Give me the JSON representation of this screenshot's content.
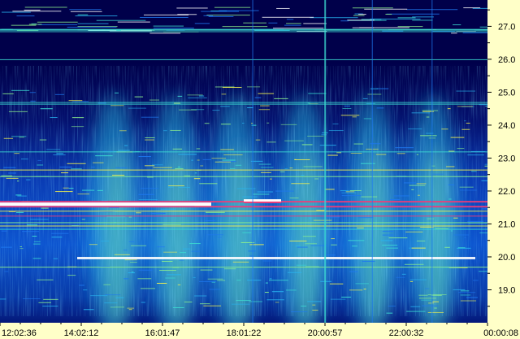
{
  "chart_data": {
    "type": "heatmap",
    "title": "",
    "xlabel": "",
    "ylabel": "",
    "x_ticks": [
      "12:02:36",
      "14:02:12",
      "16:01:47",
      "18:01:22",
      "20:00:57",
      "22:00:32",
      "00:00:08"
    ],
    "y_ticks": [
      27.0,
      26.0,
      25.0,
      24.0,
      23.0,
      22.0,
      21.0,
      20.0,
      19.0
    ],
    "ylim": [
      18.0,
      27.8
    ],
    "xlim": [
      "12:02:36",
      "00:00:08"
    ],
    "grid": false,
    "colormap": [
      "#00006a",
      "#0a32c8",
      "#1e78f0",
      "#28b4f0",
      "#3cdcd2",
      "#8cf08c",
      "#f0f050",
      "#f03c78",
      "#ffffff"
    ],
    "strong_lines_y": [
      26.92,
      21.55,
      21.4,
      21.25,
      21.05,
      20.95,
      20.0,
      19.7,
      22.65,
      22.45,
      21.7
    ],
    "interference_bursts_x": [
      "14:50",
      "16:20",
      "17:50",
      "19:30",
      "21:10",
      "22:40"
    ],
    "colors": {
      "axis_background": "#ffffc8",
      "plot_background": "#000050",
      "text": "#000000"
    }
  }
}
